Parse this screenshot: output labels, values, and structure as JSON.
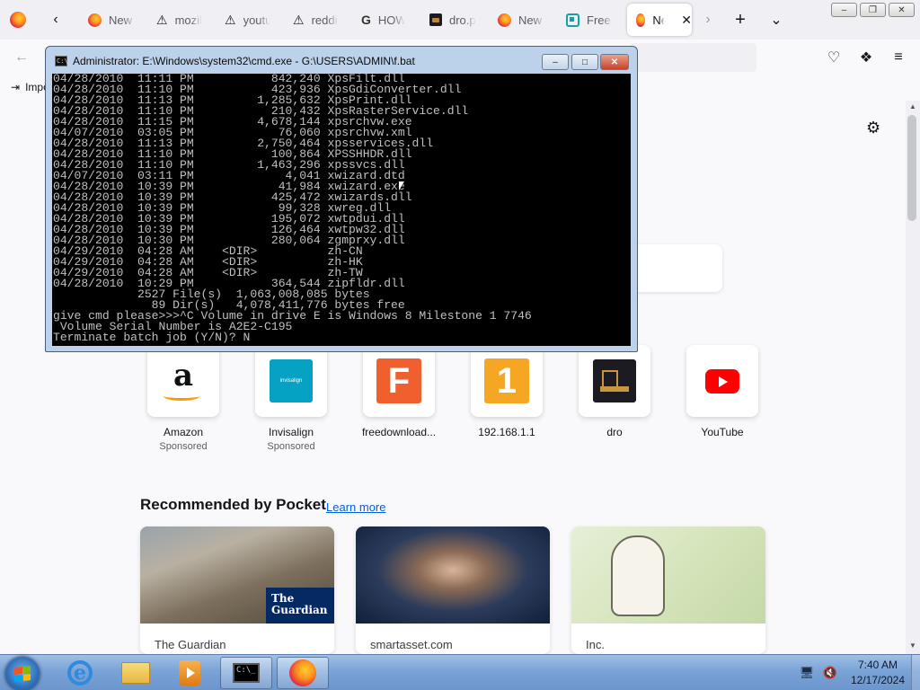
{
  "browser": {
    "tabs": [
      {
        "title": "New Tab",
        "icon": "firefox-icon"
      },
      {
        "title": "mozilla",
        "icon": "warning-icon"
      },
      {
        "title": "youtube",
        "icon": "warning-icon"
      },
      {
        "title": "reddit",
        "icon": "warning-icon"
      },
      {
        "title": "HOW",
        "icon": "google-icon"
      },
      {
        "title": "dro.p",
        "icon": "dro-icon"
      },
      {
        "title": "New Tab",
        "icon": "firefox-icon"
      },
      {
        "title": "Free D",
        "icon": "free-icon"
      },
      {
        "title": "New Tab",
        "icon": "firefox-icon",
        "active": true
      }
    ],
    "bookmarks_import_label": "Import bookmarks...",
    "top_sites": [
      {
        "name": "Amazon",
        "sponsored": "Sponsored",
        "icon": "amazon-icon",
        "glyph": "a"
      },
      {
        "name": "Invisalign",
        "sponsored": "Sponsored",
        "icon": "invisalign-icon",
        "glyph": "invisalign"
      },
      {
        "name": "freedownload...",
        "icon": "freedownload-icon",
        "glyph": "F"
      },
      {
        "name": "192.168.1.1",
        "icon": "router-icon",
        "glyph": "1"
      },
      {
        "name": "dro",
        "icon": "dro-icon"
      },
      {
        "name": "YouTube",
        "icon": "youtube-icon"
      }
    ],
    "pocket": {
      "title": "Recommended by Pocket",
      "learn_more": "Learn more",
      "cards": [
        {
          "source": "The Guardian",
          "badge": "The Guardian"
        },
        {
          "source": "smartasset.com"
        },
        {
          "source": "Inc."
        }
      ]
    }
  },
  "cmd": {
    "title": "Administrator: E:\\Windows\\system32\\cmd.exe - G:\\USERS\\ADMIN\\f.bat",
    "lines": [
      "04/28/2010  11:11 PM           842,240 XpsFilt.dll",
      "04/28/2010  11:10 PM           423,936 XpsGdiConverter.dll",
      "04/28/2010  11:13 PM         1,285,632 XpsPrint.dll",
      "04/28/2010  11:10 PM           210,432 XpsRasterService.dll",
      "04/28/2010  11:15 PM         4,678,144 xpsrchvw.exe",
      "04/07/2010  03:05 PM            76,060 xpsrchvw.xml",
      "04/28/2010  11:13 PM         2,750,464 xpsservices.dll",
      "04/28/2010  11:10 PM           100,864 XPSSHHDR.dll",
      "04/28/2010  11:10 PM         1,463,296 xpssvcs.dll",
      "04/07/2010  03:11 PM             4,041 xwizard.dtd",
      "04/28/2010  10:39 PM            41,984 xwizard.exe",
      "04/28/2010  10:39 PM           425,472 xwizards.dll",
      "04/28/2010  10:39 PM            99,328 xwreg.dll",
      "04/28/2010  10:39 PM           195,072 xwtpdui.dll",
      "04/28/2010  10:39 PM           126,464 xwtpw32.dll",
      "04/28/2010  10:30 PM           280,064 zgmprxy.dll",
      "04/29/2010  04:28 AM    <DIR>          zh-CN",
      "04/29/2010  04:28 AM    <DIR>          zh-HK",
      "04/29/2010  04:28 AM    <DIR>          zh-TW",
      "04/28/2010  10:29 PM           364,544 zipfldr.dll",
      "            2527 File(s)  1,063,008,085 bytes",
      "              89 Dir(s)   4,078,411,776 bytes free",
      "give cmd please>>>^C Volume in drive E is Windows 8 Milestone 1 7746",
      " Volume Serial Number is A2E2-C195",
      "Terminate batch job (Y/N)? N"
    ]
  },
  "taskbar": {
    "clock_time": "7:40 AM",
    "clock_date": "12/17/2024",
    "items": [
      "internet-explorer",
      "windows-explorer",
      "media-center",
      "command-prompt",
      "firefox"
    ]
  },
  "colors": {
    "firefox_accent": "#0060df",
    "taskbar": "#7aa3d6",
    "console_bg": "#000000",
    "console_text": "#c0c0c0"
  }
}
